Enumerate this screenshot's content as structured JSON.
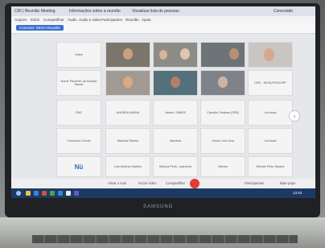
{
  "titlebar": {
    "tab1": "CRI | Reunião Meeting",
    "tab2": "Informações sobre a reunião",
    "tab3": "Visualizar lista de pessoas",
    "right": "Conectado"
  },
  "menubar": {
    "items": [
      "Arquivo",
      "Exibir",
      "Compartilhar",
      "Áudio",
      "Áudio e vídeo",
      "Participantes",
      "Reunião",
      "Ajuda"
    ]
  },
  "toolbar": {
    "chip": "Conectar: SESA-Reunião"
  },
  "tiles": {
    "r1c1": "Vídeo",
    "r2c1": "Nome Paciente da Sessão Saúde",
    "r2c6": "CRS - SESA/FNCM RP",
    "r3c1": "PAS",
    "r3c2": "ANDREA MARIA",
    "r3c3": "Jardim / MMDS",
    "r3c4": "Claudia Cristiane (SPA)",
    "r3c5": "Lia Assis",
    "r4c1": "Consórcio Conde",
    "r4c2": "Marcela Ribeiro",
    "r4c3": "Mariana",
    "r4c4": "Jonas Leal Lima",
    "r4c5": "Lia Assis",
    "r5c1": "Nü",
    "r5c2": "Luiz Antônio Martins",
    "r5c3": "Mônica Pinto - Ipanema",
    "r5c4": "Marina",
    "r5c5": "Renato Pinto Santos"
  },
  "controls": {
    "mute": "Ativar o som",
    "video": "Iniciar vídeo",
    "share": "Compartilhar",
    "participants": "Participantes",
    "chat": "Bate-papo"
  },
  "taskbar": {
    "time": "13:43"
  },
  "laptop": {
    "brand": "SAMSUNG"
  }
}
